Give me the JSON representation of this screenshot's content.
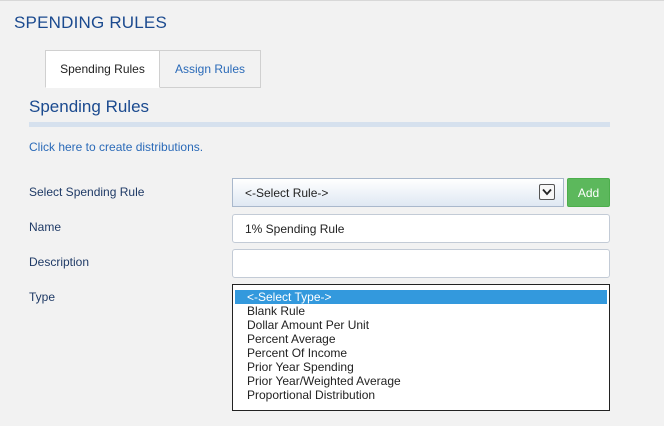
{
  "page": {
    "title": "SPENDING RULES"
  },
  "tabs": [
    {
      "label": "Spending Rules",
      "active": true
    },
    {
      "label": "Assign Rules",
      "active": false
    }
  ],
  "section": {
    "title": "Spending Rules",
    "create_link": "Click here to create distributions."
  },
  "form": {
    "select_rule_label": "Select Spending Rule",
    "select_rule_value": "<-Select Rule->",
    "add_label": "Add",
    "name_label": "Name",
    "name_value": "1% Spending Rule",
    "description_label": "Description",
    "description_value": "",
    "type_label": "Type",
    "type_options": [
      "<-Select Type->",
      "Blank Rule",
      "Dollar Amount Per Unit",
      "Percent Average",
      "Percent Of Income",
      "Prior Year Spending",
      "Prior Year/Weighted Average",
      "Proportional Distribution"
    ],
    "type_selected": "<-Select Type->"
  },
  "colors": {
    "accent": "#1b4a8f",
    "link": "#2a6ab8",
    "add_button": "#5cb85c",
    "selection": "#3399dd"
  }
}
